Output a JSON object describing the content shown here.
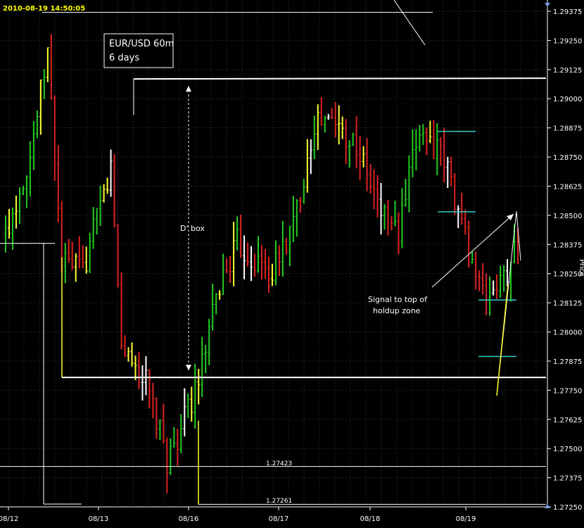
{
  "timestamp": "2010-08-19  14:50:05",
  "chart_data": {
    "type": "ohlc",
    "title": "EUR/USD 60m",
    "subtitle": "6 days",
    "ylabel": "Price",
    "ylim": [
      1.2725,
      1.2945
    ],
    "y_ticks": [
      "1.29375",
      "1.29250",
      "1.29125",
      "1.29000",
      "1.28875",
      "1.28750",
      "1.28625",
      "1.28500",
      "1.28375",
      "1.28250",
      "1.28125",
      "1.28000",
      "1.27875",
      "1.27750",
      "1.27625",
      "1.27500",
      "1.27375",
      "1.27250"
    ],
    "x_tick_labels": [
      "08/12",
      "08/13",
      "08/16",
      "08/17",
      "08/18",
      "08/19"
    ],
    "grid": true,
    "colors": {
      "up": "#22cc22",
      "down": "#dd2222",
      "neutral": "#ffffff",
      "signal": "#ffff33",
      "level": "#ffffff",
      "zone": "#33cccc"
    },
    "levels": [
      {
        "label": "D' box top",
        "value": 1.29085
      },
      {
        "label": "D' box bottom",
        "value": 1.27805
      },
      {
        "label": "1.27423",
        "value": 1.27423
      },
      {
        "label": "1.27261",
        "value": 1.27261
      }
    ],
    "holdup_zone": {
      "top": 1.28515,
      "bottom": 1.27895
    },
    "annotations": [
      {
        "text": "D' box"
      },
      {
        "text": "Signal to top of holdup zone"
      }
    ]
  },
  "labels": {
    "dbox": "D' box",
    "signal_line1": "Signal to top of",
    "signal_line2": "holdup zone",
    "level_1": "1.27423",
    "level_2": "1.27261",
    "price_axis": "Price"
  }
}
